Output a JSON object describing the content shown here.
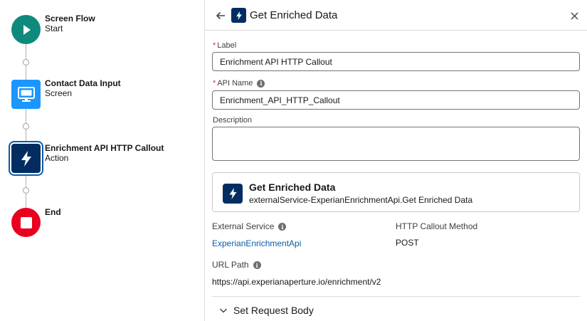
{
  "flow": {
    "nodes": [
      {
        "title": "Screen Flow",
        "subtitle": "Start",
        "type": "start",
        "color": "#0e8a7c",
        "icon": "play-icon"
      },
      {
        "title": "Contact Data Input",
        "subtitle": "Screen",
        "type": "screen",
        "color": "#1b96ff",
        "icon": "monitor-icon"
      },
      {
        "title": "Enrichment API HTTP Callout",
        "subtitle": "Action",
        "type": "action",
        "color": "#032d60",
        "icon": "lightning-icon",
        "selected": true
      },
      {
        "title": "End",
        "subtitle": "",
        "type": "end",
        "color": "#ea001e",
        "icon": "stop-icon"
      }
    ]
  },
  "panel": {
    "title": "Get Enriched Data",
    "header_icon": "lightning-icon",
    "label_field": {
      "label": "Label",
      "value": "Enrichment API HTTP Callout",
      "required": "*"
    },
    "api_name_field": {
      "label": "API Name",
      "value": "Enrichment_API_HTTP_Callout",
      "required": "*"
    },
    "description_field": {
      "label": "Description",
      "value": ""
    },
    "action_card": {
      "title": "Get Enriched Data",
      "subtitle": "externalService-ExperianEnrichmentApi.Get Enriched Data",
      "icon": "lightning-icon"
    },
    "external_service": {
      "label": "External Service",
      "value": "ExperianEnrichmentApi"
    },
    "http_method": {
      "label": "HTTP Callout Method",
      "value": "POST"
    },
    "url_path": {
      "label": "URL Path",
      "value": "https://api.experianaperture.io/enrichment/v2"
    },
    "section": {
      "label": "Set Request Body"
    }
  },
  "colors": {
    "accent": "#0b5cab",
    "required": "#c23934",
    "header_icon_bg": "#032d60"
  }
}
